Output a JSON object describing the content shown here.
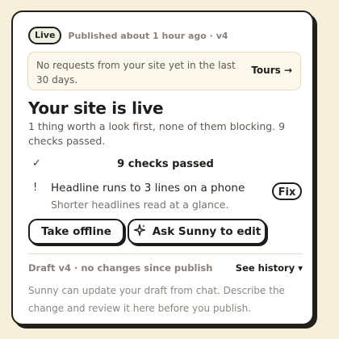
{
  "status": {
    "badge": "Live",
    "published": "Published about 1 hour ago · v4"
  },
  "notice": {
    "text": "No requests from your site yet in the last 30 days.",
    "link": "Tours →"
  },
  "main": {
    "title": "Your site is live",
    "subtitle": "1 thing worth a look first, none of them blocking. 9 checks passed."
  },
  "checks": {
    "icon": "check-mark",
    "label": "9 checks passed"
  },
  "issue": {
    "icon": "exclamation",
    "title": "Headline runs to 3 lines on a phone",
    "detail": "Shorter headlines read at a glance.",
    "action": "Fix"
  },
  "actions": {
    "offline": "Take offline",
    "ask": "Ask Sunny to edit",
    "ask_icon": "sparkle-icon"
  },
  "draft": {
    "label": "Draft v4 · no changes since publish",
    "history": "See history ▾",
    "help": "Sunny can update your draft from chat. Describe the change and review it here before you publish."
  },
  "colors": {
    "background": "#f5efd9",
    "card": "#ffffff",
    "border": "#1f1c1a",
    "badge_bg": "#eaf1e3",
    "notice_bg": "#fcf8ec"
  }
}
